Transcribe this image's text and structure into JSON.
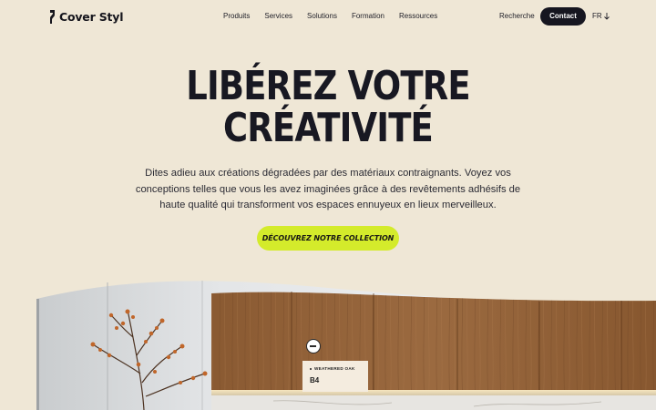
{
  "brand": {
    "name": "Cover Styl"
  },
  "nav": {
    "items": [
      {
        "label": "Produits"
      },
      {
        "label": "Services"
      },
      {
        "label": "Solutions"
      },
      {
        "label": "Formation"
      },
      {
        "label": "Ressources"
      }
    ],
    "search_label": "Recherche",
    "contact_label": "Contact",
    "lang_label": "FR",
    "lang_icon": "arrow-down-icon"
  },
  "hero": {
    "title_line1": "LIBÉREZ VOTRE",
    "title_line2": "CRÉATIVITÉ",
    "description": "Dites adieu aux créations dégradées par des matériaux contraignants. Voyez vos conceptions telles que vous les avez imaginées grâce à des revêtements adhésifs de haute qualité qui transforment vos espaces ennuyeux en lieux merveilleux.",
    "cta_label": "DÉCOUVREZ NOTRE COLLECTION"
  },
  "product_tag": {
    "name": "WEATHERED OAK",
    "code": "B4",
    "hotspot_icon": "minus-icon"
  },
  "colors": {
    "background": "#efe7d6",
    "accent": "#d4eb2b",
    "dark": "#161620"
  }
}
